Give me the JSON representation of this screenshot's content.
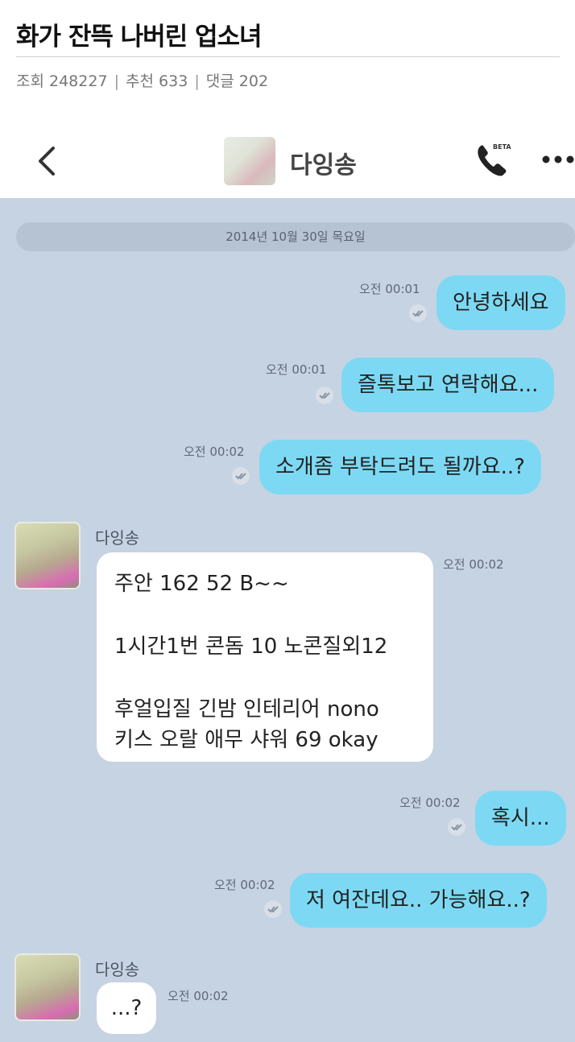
{
  "post": {
    "title": "화가 잔뜩 나버린 업소녀",
    "views": "조회 248227",
    "likes": "추천 633",
    "comments": "댓글 202",
    "separator": "|"
  },
  "chat_header": {
    "back_icon": "chevron-left-icon",
    "contact_name": "다잉송",
    "call_icon": "phone-icon",
    "call_badge": "BETA",
    "more_icon": "more-icon"
  },
  "chat": {
    "date": "2014년 10월 30일 목요일",
    "sender_name": "다잉송",
    "messages": [
      {
        "direction": "out",
        "text": "안녕하세요",
        "time": "오전 00:01"
      },
      {
        "direction": "out",
        "text": "즐톡보고 연락해요...",
        "time": "오전 00:01"
      },
      {
        "direction": "out",
        "text": "소개좀 부탁드려도 될까요..?",
        "time": "오전 00:02"
      },
      {
        "direction": "in",
        "lines": [
          "주안 162 52 B~~",
          "1시간1번 콘돔 10 노콘질외12",
          "후얼입질 긴밤 인테리어 nono",
          "키스 오랄 애무 샤워 69 okay"
        ],
        "time": "오전 00:02"
      },
      {
        "direction": "out",
        "text": "혹시...",
        "time": "오전 00:02"
      },
      {
        "direction": "out",
        "text": "저 여잔데요.. 가능해요..?",
        "time": "오전 00:02"
      },
      {
        "direction": "in",
        "text": "...?",
        "time": "오전 00:02"
      }
    ]
  },
  "colors": {
    "chat_bg": "#c6d3e2",
    "outgoing_bubble": "#7dd9f3",
    "incoming_bubble": "#ffffff"
  }
}
